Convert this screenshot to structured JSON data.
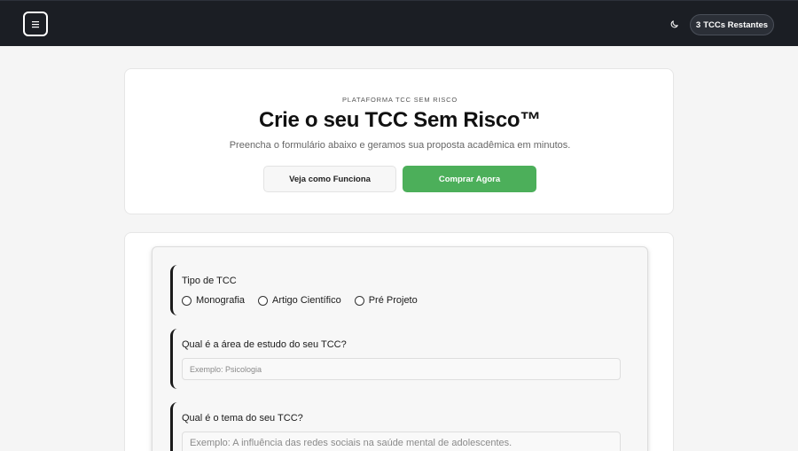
{
  "header": {
    "menu_icon": "hamburger-menu-icon",
    "theme_icon": "moon-icon",
    "credits_count": "3",
    "credits_label": "TCCs Restantes"
  },
  "hero": {
    "eyebrow": "PLATAFORMA TCC SEM RISCO",
    "title": "Crie o seu TCC Sem Risco™",
    "subtitle": "Preencha o formulário abaixo e geramos sua proposta acadêmica em minutos.",
    "how_button": "Veja como Funciona",
    "buy_button": "Comprar Agora"
  },
  "form": {
    "type_label": "Tipo de TCC",
    "type_options": [
      "Monografia",
      "Artigo Científico",
      "Pré Projeto"
    ],
    "area_label": "Qual é a área de estudo do seu TCC?",
    "area_placeholder": "Exemplo: Psicologia",
    "theme_label": "Qual é o tema do seu TCC?",
    "theme_placeholder": "Exemplo: A influência das redes sociais na saúde mental de adolescentes."
  },
  "colors": {
    "header_bg": "#1b1e24",
    "accent_green": "#4caf5a",
    "page_bg": "#f5f5f5"
  }
}
